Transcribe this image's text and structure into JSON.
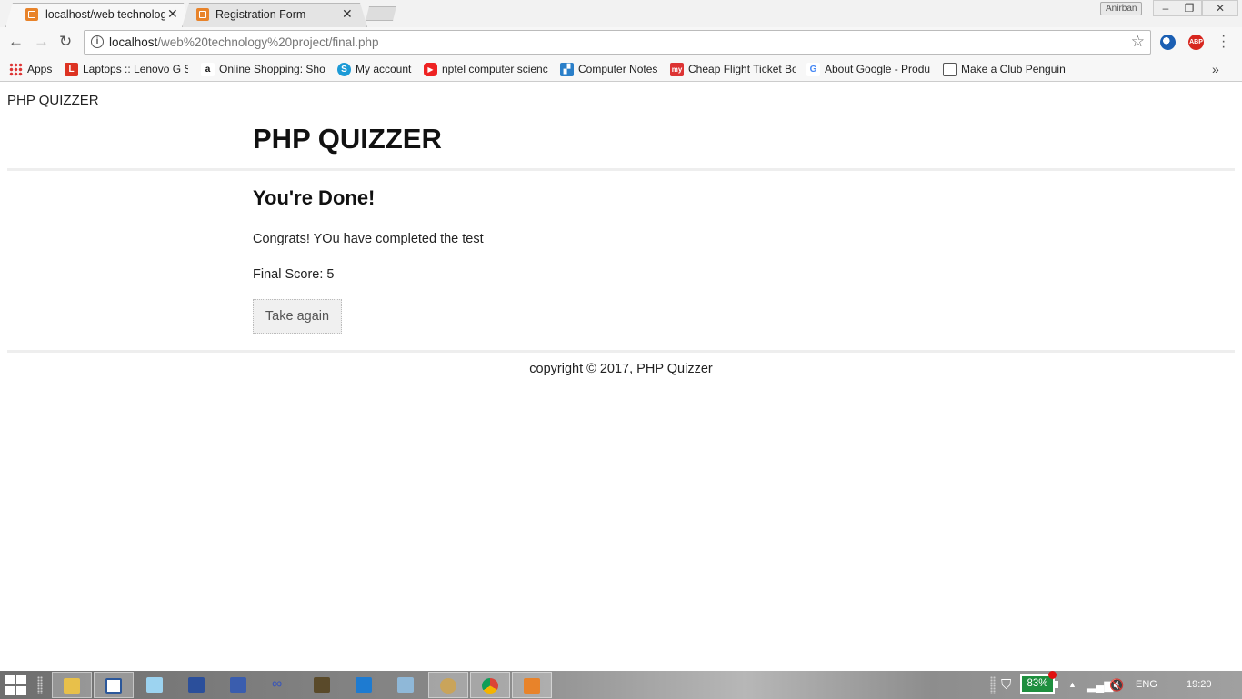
{
  "browser": {
    "tabs": [
      {
        "title": "localhost/web technolog",
        "active": true
      },
      {
        "title": "Registration Form",
        "active": false
      }
    ],
    "profile_name": "Anirban",
    "address": {
      "host": "localhost",
      "path": "/web%20technology%20project/final.php"
    },
    "extensions": [
      "abp-icon",
      "globe-icon"
    ],
    "bookmarks": [
      {
        "label": "Apps",
        "icon": "apps-icon"
      },
      {
        "label": "Laptops :: Lenovo G S",
        "icon": "lenovo-icon"
      },
      {
        "label": "Online Shopping: Sho",
        "icon": "amazon-icon"
      },
      {
        "label": "My account",
        "icon": "skype-icon"
      },
      {
        "label": "nptel computer scienc",
        "icon": "youtube-icon"
      },
      {
        "label": "Computer Notes",
        "icon": "notes-icon"
      },
      {
        "label": "Cheap Flight Ticket Bo",
        "icon": "makemytrip-icon"
      },
      {
        "label": "About Google - Produ",
        "icon": "google-icon"
      },
      {
        "label": "Make a Club Penguin",
        "icon": "folder-icon"
      }
    ]
  },
  "page": {
    "brand": "PHP QUIZZER",
    "heading": "PHP QUIZZER",
    "done_title": "You're Done!",
    "congrats": "Congrats! YOu have completed the test",
    "final_score": "Final Score: 5",
    "retake_button": "Take again",
    "footer": "copyright © 2017, PHP Quizzer"
  },
  "taskbar": {
    "battery_percent": "83%",
    "language": "ENG",
    "time": "19:20"
  },
  "colors": {
    "tab_favicon": "#e8832a",
    "battery_fill": "#1f8f3f",
    "abp_red": "#d7261e"
  }
}
